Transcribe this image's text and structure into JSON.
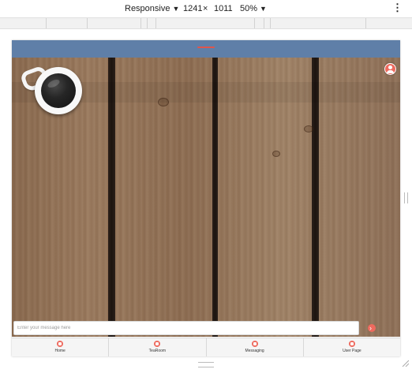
{
  "devtools": {
    "device": "Responsive",
    "width": "1241",
    "times": "×",
    "height": "1011",
    "zoom": "50%",
    "caret": "▼",
    "more": "⋮"
  },
  "app": {
    "message_placeholder": "Enter your message here",
    "send_glyph": "›",
    "nav": [
      {
        "label": "Home",
        "icon": "home-icon"
      },
      {
        "label": "TeaRoom",
        "icon": "chat-icon"
      },
      {
        "label": "Messaging",
        "icon": "monitor-icon"
      },
      {
        "label": "User Page",
        "icon": "user-icon"
      }
    ]
  },
  "colors": {
    "header": "#5f7fa8",
    "accent": "#ee6a5e"
  }
}
